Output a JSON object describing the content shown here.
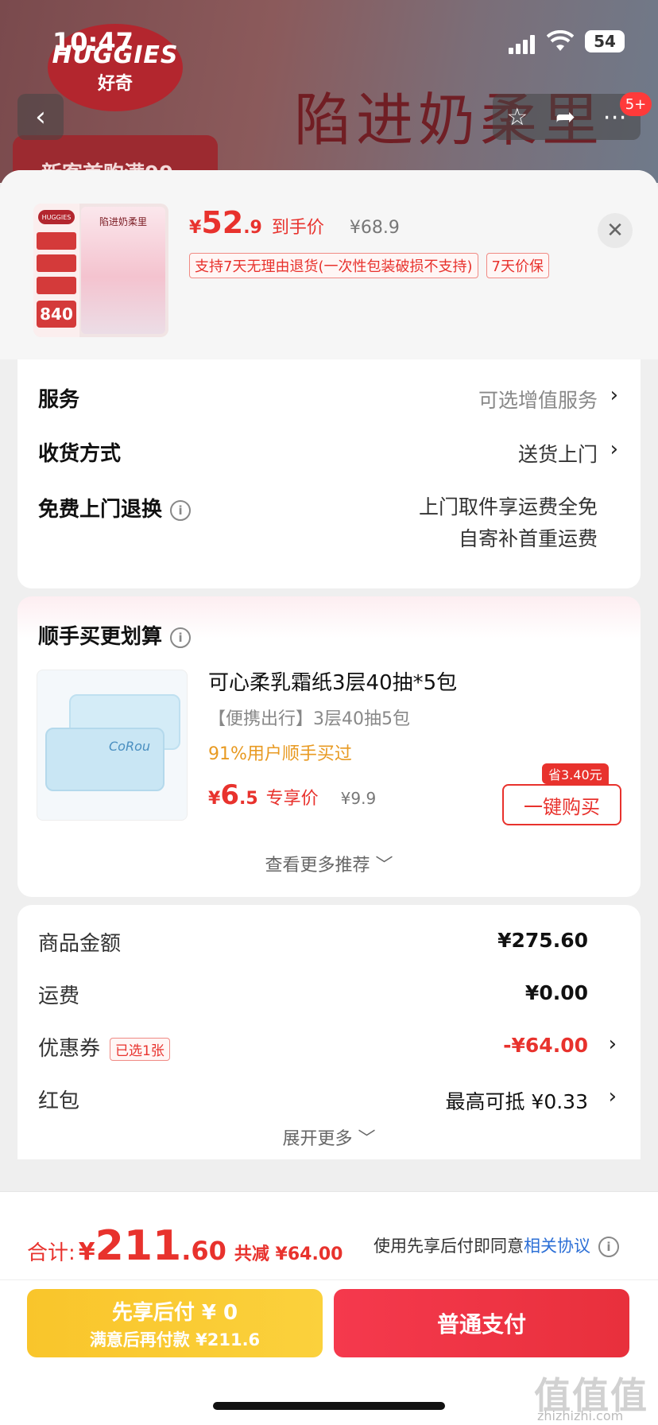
{
  "status_bar": {
    "time": "10:47",
    "battery": "54"
  },
  "background": {
    "brand_logo_line1": "HUGGIES",
    "brand_logo_line2": "好奇",
    "headline": "陷进奶柔里",
    "promo": "新客首购满99",
    "back_icon": "‹",
    "notification_count": "5+"
  },
  "product": {
    "thumb_title": "陷进奶柔里",
    "thumb_price_badge": "840",
    "price_symbol": "¥",
    "price_int": "52",
    "price_dec": ".9",
    "price_label": "到手价",
    "original_price": "¥68.9",
    "tags": [
      "支持7天无理由退货(一次性包装破损不支持)",
      "7天价保"
    ]
  },
  "services": {
    "service_label": "服务",
    "service_value": "可选增值服务",
    "delivery_label": "收货方式",
    "delivery_value": "送货上门",
    "return_label": "免费上门退换",
    "return_value_line1": "上门取件享运费全免",
    "return_value_line2": "自寄补首重运费"
  },
  "recommend": {
    "title": "顺手买更划算",
    "item_brand": "CoRou",
    "item_name": "可心柔乳霜纸3层40抽*5包",
    "item_sub": "【便携出行】3层40抽5包",
    "item_pct": "91%用户顺手买过",
    "price_symbol": "¥",
    "price_int": "6",
    "price_dec": ".5",
    "price_label": "专享价",
    "original_price": "¥9.9",
    "save_tag": "省3.40元",
    "buy_label": "一键购买",
    "more_label": "查看更多推荐 ﹀"
  },
  "amounts": {
    "goods_label": "商品金额",
    "goods_value": "¥275.60",
    "shipping_label": "运费",
    "shipping_value": "¥0.00",
    "coupon_label": "优惠券",
    "coupon_tag": "已选1张",
    "coupon_value": "-¥64.00",
    "redpacket_label": "红包",
    "redpacket_value": "最高可抵 ¥0.33",
    "expand_label": "展开更多 ﹀"
  },
  "bottom": {
    "total_label": "合计:",
    "total_symbol": "¥",
    "total_int": "211",
    "total_dec": ".60",
    "total_discount": "共减 ¥64.00",
    "agree_text": "使用先享后付即同意",
    "agree_link": "相关协议",
    "pay_later_line1": "先享后付 ¥ 0",
    "pay_later_line2": "满意后再付款 ¥211.6",
    "pay_normal": "普通支付",
    "watermark": "值值值",
    "watermark_sub": "zhizhizhi.com"
  },
  "colors": {
    "accent_red": "#e8322d",
    "pay_yellow": "#f9c52b",
    "link_blue": "#2c6fd6"
  }
}
